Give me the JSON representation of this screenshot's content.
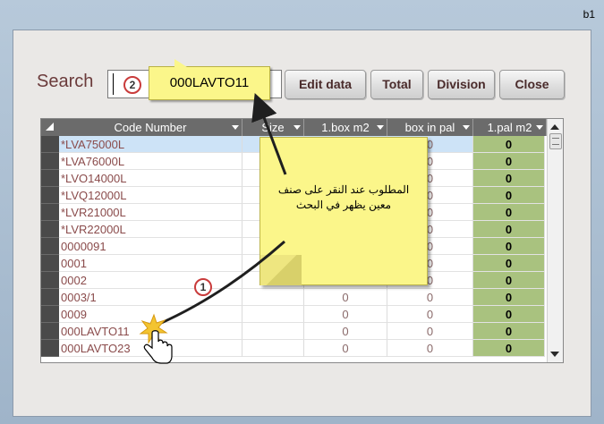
{
  "window": {
    "title": "b1"
  },
  "search": {
    "label": "Search",
    "value": ""
  },
  "buttons": {
    "edit": "Edit data",
    "total": "Total",
    "division": "Division",
    "close": "Close"
  },
  "grid": {
    "columns": [
      "Code Number",
      "Size",
      "1.box m2",
      "box in pal",
      "1.pal m2"
    ],
    "rows": [
      {
        "code": "*LVA75000L",
        "size": "",
        "box": "",
        "pal": "0",
        "palm2": "0"
      },
      {
        "code": "*LVA76000L",
        "size": "",
        "box": "",
        "pal": "0",
        "palm2": "0"
      },
      {
        "code": "*LVO14000L",
        "size": "",
        "box": "",
        "pal": "0",
        "palm2": "0"
      },
      {
        "code": "*LVQ12000L",
        "size": "",
        "box": "",
        "pal": "0",
        "palm2": "0"
      },
      {
        "code": "*LVR21000L",
        "size": "",
        "box": "",
        "pal": "0",
        "palm2": "0"
      },
      {
        "code": "*LVR22000L",
        "size": "",
        "box": "",
        "pal": "0",
        "palm2": "0"
      },
      {
        "code": "0000091",
        "size": "",
        "box": "",
        "pal": "0",
        "palm2": "0"
      },
      {
        "code": "0001",
        "size": "",
        "box": "",
        "pal": "0",
        "palm2": "0"
      },
      {
        "code": "0002",
        "size": "",
        "box": "",
        "pal": "0",
        "palm2": "0"
      },
      {
        "code": "0003/1",
        "size": "",
        "box": "0",
        "pal": "0",
        "palm2": "0"
      },
      {
        "code": "0009",
        "size": "",
        "box": "0",
        "pal": "0",
        "palm2": "0"
      },
      {
        "code": "000LAVTO11",
        "size": "",
        "box": "0",
        "pal": "0",
        "palm2": "0"
      },
      {
        "code": "000LAVTO23",
        "size": "",
        "box": "0",
        "pal": "0",
        "palm2": "0"
      }
    ]
  },
  "annotations": {
    "callout_value": "000LAVTO11",
    "badge_1": "1",
    "badge_2": "2",
    "note_text": "المطلوب عند النقر على صنف معين يظهر في البحث"
  },
  "colors": {
    "highlight_column": "#a9c27f",
    "selected_row": "#cde3f7",
    "callout_yellow": "#fbf68a",
    "badge_border": "#c93b3b"
  }
}
